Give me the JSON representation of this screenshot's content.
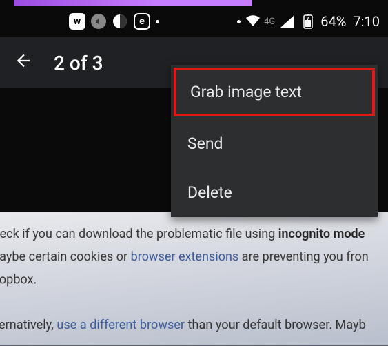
{
  "status_bar": {
    "app_icons": {
      "w_label": "w",
      "e_label": "e"
    },
    "network": "4G",
    "battery_pct": "64%",
    "clock": "7:10"
  },
  "app_bar": {
    "title": "2 of 3"
  },
  "menu": {
    "items": [
      {
        "label": "Grab image text",
        "highlighted": true
      },
      {
        "label": "Send",
        "highlighted": false
      },
      {
        "label": "Delete",
        "highlighted": false
      }
    ]
  },
  "photo_text": {
    "l1a": "eck if you can download the problematic file using ",
    "l1b": "incognito mode",
    "l2a": "aybe certain cookies or ",
    "l2b": "browser extensions",
    "l2c": " are preventing you fron",
    "l3": "opbox.",
    "l4a": "ernatively, ",
    "l4b": "use a different browser",
    "l4c": " than your default browser. Mayb"
  }
}
